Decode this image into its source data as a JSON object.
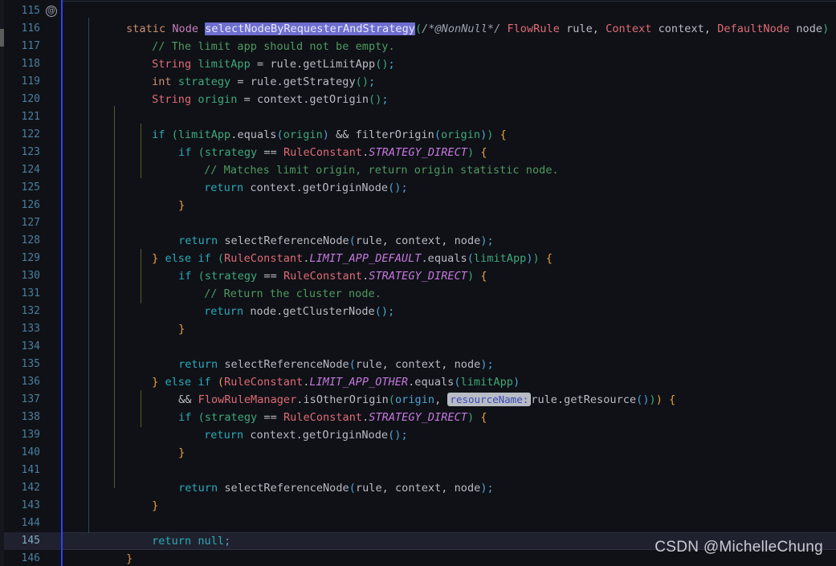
{
  "editor": {
    "background": "#0f1117",
    "caret_bar_color": "#2f40f7",
    "selection_color": "#6e6ed0",
    "current_line": 145,
    "gutter_annotation_icon": "@",
    "first_visible_line": 115,
    "last_visible_line": 146
  },
  "watermark": {
    "text": "CSDN @MichelleChung"
  },
  "lines": [
    {
      "num": "115",
      "annotation": "@"
    },
    {
      "num": "116"
    },
    {
      "num": "117"
    },
    {
      "num": "118"
    },
    {
      "num": "119"
    },
    {
      "num": "120"
    },
    {
      "num": "121"
    },
    {
      "num": "122"
    },
    {
      "num": "123"
    },
    {
      "num": "124"
    },
    {
      "num": "125"
    },
    {
      "num": "126"
    },
    {
      "num": "127"
    },
    {
      "num": "128"
    },
    {
      "num": "129"
    },
    {
      "num": "130"
    },
    {
      "num": "131"
    },
    {
      "num": "132"
    },
    {
      "num": "133"
    },
    {
      "num": "134"
    },
    {
      "num": "135"
    },
    {
      "num": "136"
    },
    {
      "num": "137"
    },
    {
      "num": "138"
    },
    {
      "num": "139"
    },
    {
      "num": "140"
    },
    {
      "num": "141"
    },
    {
      "num": "142"
    },
    {
      "num": "143"
    },
    {
      "num": "144"
    },
    {
      "num": "145"
    },
    {
      "num": "146"
    }
  ],
  "code": {
    "l115": "static Node selectNodeByRequesterAndStrategy(/*@NonNull*/ FlowRule rule, Context context, DefaultNode node) {",
    "l115_sel": "selectNodeByRequesterAndStrategy",
    "l116": "// The limit app should not be empty.",
    "l117": "String limitApp = rule.getLimitApp();",
    "l118": "int strategy = rule.getStrategy();",
    "l119": "String origin = context.getOrigin();",
    "l121": "if (limitApp.equals(origin) && filterOrigin(origin)) {",
    "l122": "if (strategy == RuleConstant.STRATEGY_DIRECT) {",
    "l123": "// Matches limit origin, return origin statistic node.",
    "l124": "return context.getOriginNode();",
    "l125": "}",
    "l127": "return selectReferenceNode(rule, context, node);",
    "l128": "} else if (RuleConstant.LIMIT_APP_DEFAULT.equals(limitApp)) {",
    "l129": "if (strategy == RuleConstant.STRATEGY_DIRECT) {",
    "l130": "// Return the cluster node.",
    "l131": "return node.getClusterNode();",
    "l132": "}",
    "l134": "return selectReferenceNode(rule, context, node);",
    "l135": "} else if (RuleConstant.LIMIT_APP_OTHER.equals(limitApp)",
    "l136": "&& FlowRuleManager.isOtherOrigin(origin, resourceName: rule.getResource())) {",
    "l136_hint": "resourceName:",
    "l137": "if (strategy == RuleConstant.STRATEGY_DIRECT) {",
    "l138": "return context.getOriginNode();",
    "l139": "}",
    "l141": "return selectReferenceNode(rule, context, node);",
    "l142": "}",
    "l144": "return null;",
    "l145": "}"
  },
  "tokens": {
    "static": "static",
    "Node": "Node",
    "nonnull": "/*@NonNull*/",
    "FlowRule": "FlowRule",
    "rule": "rule",
    "Context": "Context",
    "context": "context",
    "DefaultNode": "DefaultNode",
    "node": "node",
    "String": "String",
    "int": "int",
    "if": "if",
    "else": "else",
    "return": "return",
    "null": "null",
    "RuleConstant": "RuleConstant",
    "STRATEGY_DIRECT": "STRATEGY_DIRECT",
    "LIMIT_APP_DEFAULT": "LIMIT_APP_DEFAULT",
    "LIMIT_APP_OTHER": "LIMIT_APP_OTHER",
    "FlowRuleManager": "FlowRuleManager",
    "limitApp": "limitApp",
    "strategy": "strategy",
    "origin": "origin",
    "getLimitApp": "getLimitApp",
    "getStrategy": "getStrategy",
    "getOrigin": "getOrigin",
    "getOriginNode": "getOriginNode",
    "getClusterNode": "getClusterNode",
    "getResource": "getResource",
    "equals": "equals",
    "filterOrigin": "filterOrigin",
    "isOtherOrigin": "isOtherOrigin",
    "selectReferenceNode": "selectReferenceNode",
    "selectNodeByRequesterAndStrategy": "selectNodeByRequesterAndStrategy",
    "comment116": "// The limit app should not be empty.",
    "comment123": "// Matches limit origin, return origin statistic node.",
    "comment130": "// Return the cluster node."
  }
}
